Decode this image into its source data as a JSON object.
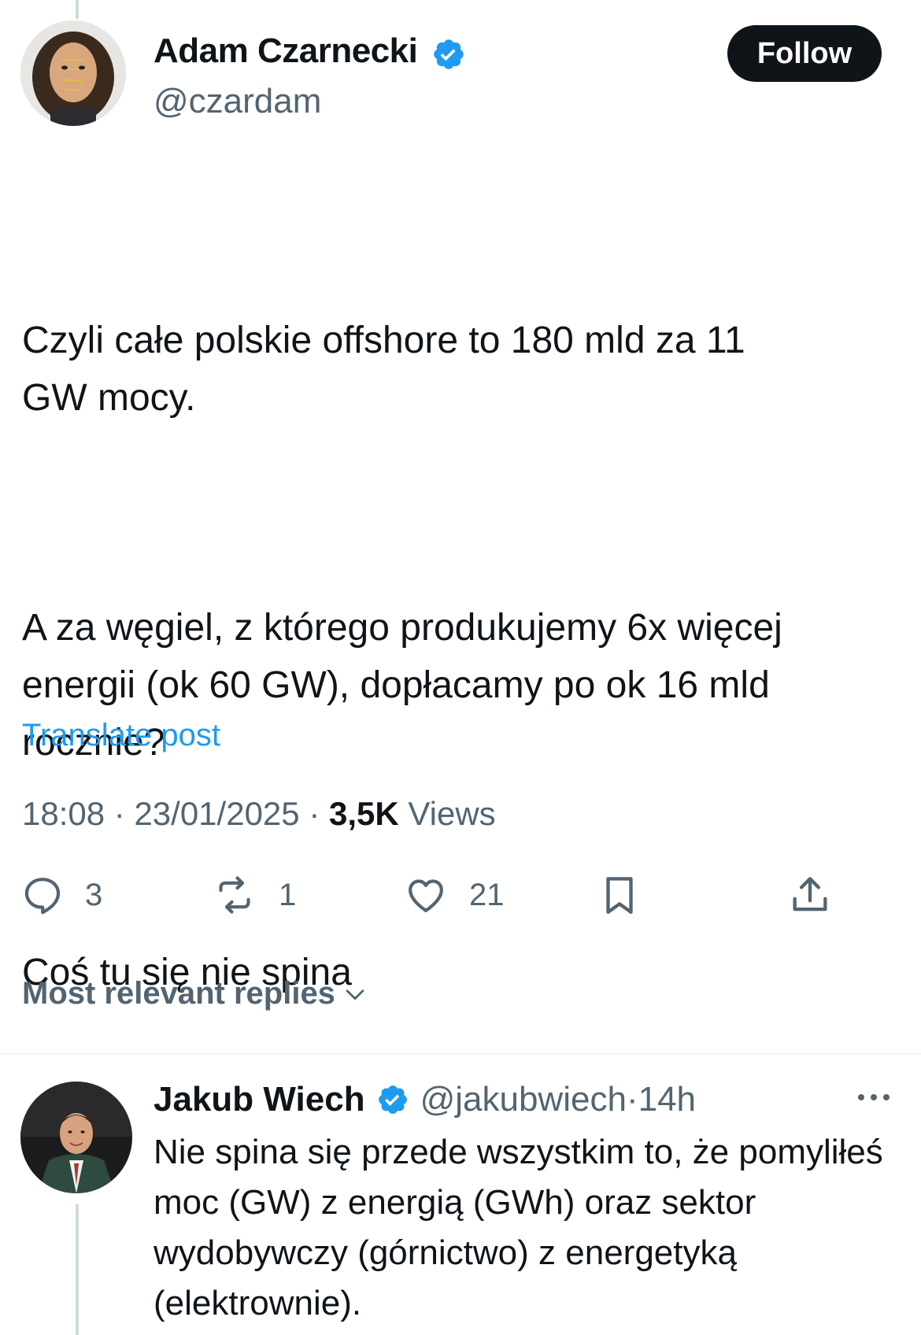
{
  "post": {
    "author": {
      "name": "Adam Czarnecki",
      "handle": "@czardam",
      "verified": true
    },
    "follow_label": "Follow",
    "paragraphs": [
      "Czyli całe polskie offshore to 180 mld za 11\nGW mocy.",
      "A za węgiel, z którego produkujemy 6x więcej\nenergii (ok 60 GW), dopłacamy po ok 16 mld\nrocznie?",
      "Coś tu się nie spina"
    ],
    "translate_label": "Translate post",
    "meta": {
      "time": "18:08",
      "separator": " · ",
      "date": "23/01/2025",
      "views_count": "3,5K",
      "views_label": " Views"
    },
    "actions": {
      "replies": "3",
      "reposts": "1",
      "likes": "21"
    }
  },
  "replies_sort_label": "Most relevant replies",
  "reply": {
    "author": {
      "name": "Jakub Wiech",
      "handle": "@jakubwiech",
      "separator": " · ",
      "age": "14h",
      "verified": true
    },
    "text": "Nie spina się przede wszystkim to, że pomyliłeś moc (GW) z energią (GWh) oraz sektor wydobywczy (górnictwo) z energetyką (elektrownie)."
  },
  "colors": {
    "accent": "#1d9bf0",
    "text_primary": "#0f1419",
    "text_secondary": "#536471",
    "follow_button_bg": "#0f1419",
    "thread_line": "#cfd9de"
  },
  "icons": [
    "verified-badge-icon",
    "reply-icon",
    "repost-icon",
    "like-icon",
    "bookmark-icon",
    "share-icon",
    "chevron-down-icon",
    "more-icon"
  ]
}
